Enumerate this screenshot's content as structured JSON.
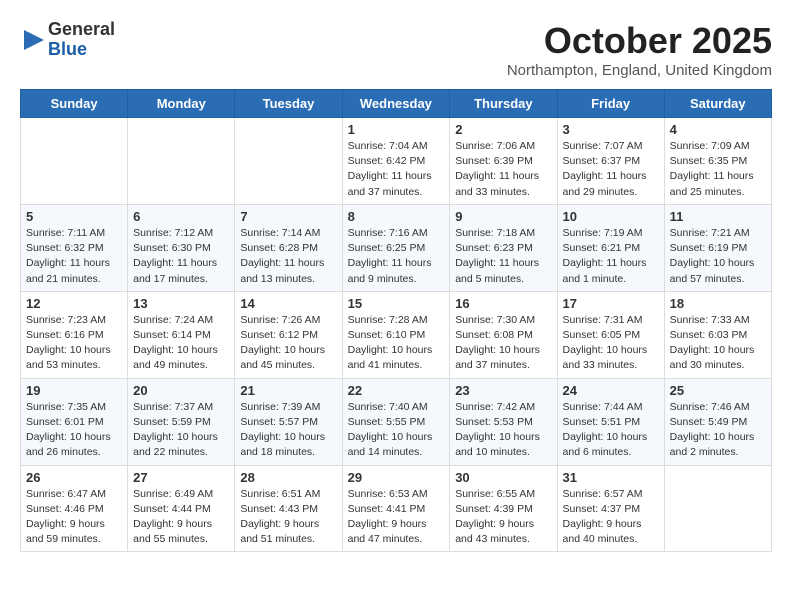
{
  "header": {
    "logo_general": "General",
    "logo_blue": "Blue",
    "month_title": "October 2025",
    "location": "Northampton, England, United Kingdom"
  },
  "calendar": {
    "days_of_week": [
      "Sunday",
      "Monday",
      "Tuesday",
      "Wednesday",
      "Thursday",
      "Friday",
      "Saturday"
    ],
    "weeks": [
      [
        {
          "day": "",
          "detail": ""
        },
        {
          "day": "",
          "detail": ""
        },
        {
          "day": "",
          "detail": ""
        },
        {
          "day": "1",
          "detail": "Sunrise: 7:04 AM\nSunset: 6:42 PM\nDaylight: 11 hours\nand 37 minutes."
        },
        {
          "day": "2",
          "detail": "Sunrise: 7:06 AM\nSunset: 6:39 PM\nDaylight: 11 hours\nand 33 minutes."
        },
        {
          "day": "3",
          "detail": "Sunrise: 7:07 AM\nSunset: 6:37 PM\nDaylight: 11 hours\nand 29 minutes."
        },
        {
          "day": "4",
          "detail": "Sunrise: 7:09 AM\nSunset: 6:35 PM\nDaylight: 11 hours\nand 25 minutes."
        }
      ],
      [
        {
          "day": "5",
          "detail": "Sunrise: 7:11 AM\nSunset: 6:32 PM\nDaylight: 11 hours\nand 21 minutes."
        },
        {
          "day": "6",
          "detail": "Sunrise: 7:12 AM\nSunset: 6:30 PM\nDaylight: 11 hours\nand 17 minutes."
        },
        {
          "day": "7",
          "detail": "Sunrise: 7:14 AM\nSunset: 6:28 PM\nDaylight: 11 hours\nand 13 minutes."
        },
        {
          "day": "8",
          "detail": "Sunrise: 7:16 AM\nSunset: 6:25 PM\nDaylight: 11 hours\nand 9 minutes."
        },
        {
          "day": "9",
          "detail": "Sunrise: 7:18 AM\nSunset: 6:23 PM\nDaylight: 11 hours\nand 5 minutes."
        },
        {
          "day": "10",
          "detail": "Sunrise: 7:19 AM\nSunset: 6:21 PM\nDaylight: 11 hours\nand 1 minute."
        },
        {
          "day": "11",
          "detail": "Sunrise: 7:21 AM\nSunset: 6:19 PM\nDaylight: 10 hours\nand 57 minutes."
        }
      ],
      [
        {
          "day": "12",
          "detail": "Sunrise: 7:23 AM\nSunset: 6:16 PM\nDaylight: 10 hours\nand 53 minutes."
        },
        {
          "day": "13",
          "detail": "Sunrise: 7:24 AM\nSunset: 6:14 PM\nDaylight: 10 hours\nand 49 minutes."
        },
        {
          "day": "14",
          "detail": "Sunrise: 7:26 AM\nSunset: 6:12 PM\nDaylight: 10 hours\nand 45 minutes."
        },
        {
          "day": "15",
          "detail": "Sunrise: 7:28 AM\nSunset: 6:10 PM\nDaylight: 10 hours\nand 41 minutes."
        },
        {
          "day": "16",
          "detail": "Sunrise: 7:30 AM\nSunset: 6:08 PM\nDaylight: 10 hours\nand 37 minutes."
        },
        {
          "day": "17",
          "detail": "Sunrise: 7:31 AM\nSunset: 6:05 PM\nDaylight: 10 hours\nand 33 minutes."
        },
        {
          "day": "18",
          "detail": "Sunrise: 7:33 AM\nSunset: 6:03 PM\nDaylight: 10 hours\nand 30 minutes."
        }
      ],
      [
        {
          "day": "19",
          "detail": "Sunrise: 7:35 AM\nSunset: 6:01 PM\nDaylight: 10 hours\nand 26 minutes."
        },
        {
          "day": "20",
          "detail": "Sunrise: 7:37 AM\nSunset: 5:59 PM\nDaylight: 10 hours\nand 22 minutes."
        },
        {
          "day": "21",
          "detail": "Sunrise: 7:39 AM\nSunset: 5:57 PM\nDaylight: 10 hours\nand 18 minutes."
        },
        {
          "day": "22",
          "detail": "Sunrise: 7:40 AM\nSunset: 5:55 PM\nDaylight: 10 hours\nand 14 minutes."
        },
        {
          "day": "23",
          "detail": "Sunrise: 7:42 AM\nSunset: 5:53 PM\nDaylight: 10 hours\nand 10 minutes."
        },
        {
          "day": "24",
          "detail": "Sunrise: 7:44 AM\nSunset: 5:51 PM\nDaylight: 10 hours\nand 6 minutes."
        },
        {
          "day": "25",
          "detail": "Sunrise: 7:46 AM\nSunset: 5:49 PM\nDaylight: 10 hours\nand 2 minutes."
        }
      ],
      [
        {
          "day": "26",
          "detail": "Sunrise: 6:47 AM\nSunset: 4:46 PM\nDaylight: 9 hours\nand 59 minutes."
        },
        {
          "day": "27",
          "detail": "Sunrise: 6:49 AM\nSunset: 4:44 PM\nDaylight: 9 hours\nand 55 minutes."
        },
        {
          "day": "28",
          "detail": "Sunrise: 6:51 AM\nSunset: 4:43 PM\nDaylight: 9 hours\nand 51 minutes."
        },
        {
          "day": "29",
          "detail": "Sunrise: 6:53 AM\nSunset: 4:41 PM\nDaylight: 9 hours\nand 47 minutes."
        },
        {
          "day": "30",
          "detail": "Sunrise: 6:55 AM\nSunset: 4:39 PM\nDaylight: 9 hours\nand 43 minutes."
        },
        {
          "day": "31",
          "detail": "Sunrise: 6:57 AM\nSunset: 4:37 PM\nDaylight: 9 hours\nand 40 minutes."
        },
        {
          "day": "",
          "detail": ""
        }
      ]
    ]
  }
}
